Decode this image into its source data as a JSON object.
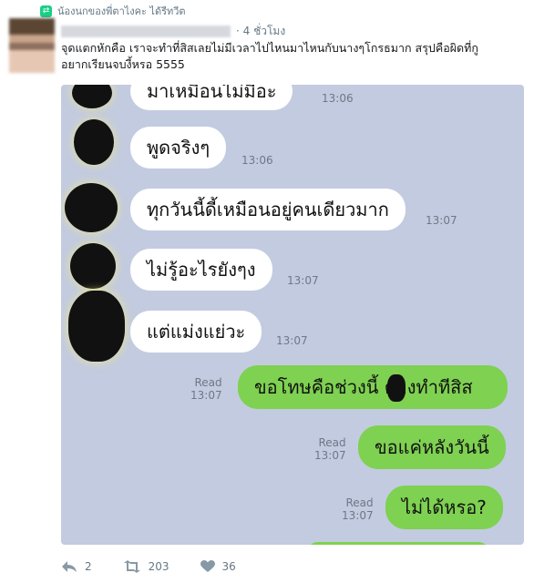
{
  "retweet": {
    "label": "น้องนกของพี่ตาไงคะ ได้รีทวีต",
    "icon": "retweet-badge-icon"
  },
  "tweet": {
    "time": "· 4 ชั่วโมง",
    "text_line1": "จุดแตกหักคือ เราจะทำที่สิสเลยไม่มีเวลาไปไหนมาไหนกับนางๆโกรธมาก สรุปคือผิดที่กู",
    "text_line2": "อยากเรียนจบงี้หรอ 5555"
  },
  "chat": {
    "messages": [
      {
        "side": "in",
        "text": "มาเหมือนไม่มีอะ",
        "time": "13:06"
      },
      {
        "side": "in",
        "text": "พูดจริงๆ",
        "time": "13:06"
      },
      {
        "side": "in",
        "text": "ทุกวันนี้ดี้เหมือนอยู่คนเดียวมาก",
        "time": "13:07"
      },
      {
        "side": "in",
        "text": "ไม่รู้อะไรยังๆง",
        "time": "13:07"
      },
      {
        "side": "in",
        "text": "แต่แม่งแย่วะ",
        "time": "13:07"
      },
      {
        "side": "out",
        "text": "ขอโทษคือช่วงนี้  ต้องทำทีสิส",
        "read": "Read",
        "time": "13:07"
      },
      {
        "side": "out",
        "text": "ขอแค่หลังวันนี้",
        "read": "Read",
        "time": "13:07"
      },
      {
        "side": "out",
        "text": "ไม่ได้หรอ?",
        "read": "Read",
        "time": "13:07"
      }
    ]
  },
  "actions": {
    "reply_count": "2",
    "retweet_count": "203",
    "like_count": "36"
  },
  "colors": {
    "chat_bg": "#c3cbe0",
    "bubble_in": "#ffffff",
    "bubble_out": "#7ed151",
    "retweet_green": "#19cf86",
    "meta_gray": "#657786"
  }
}
